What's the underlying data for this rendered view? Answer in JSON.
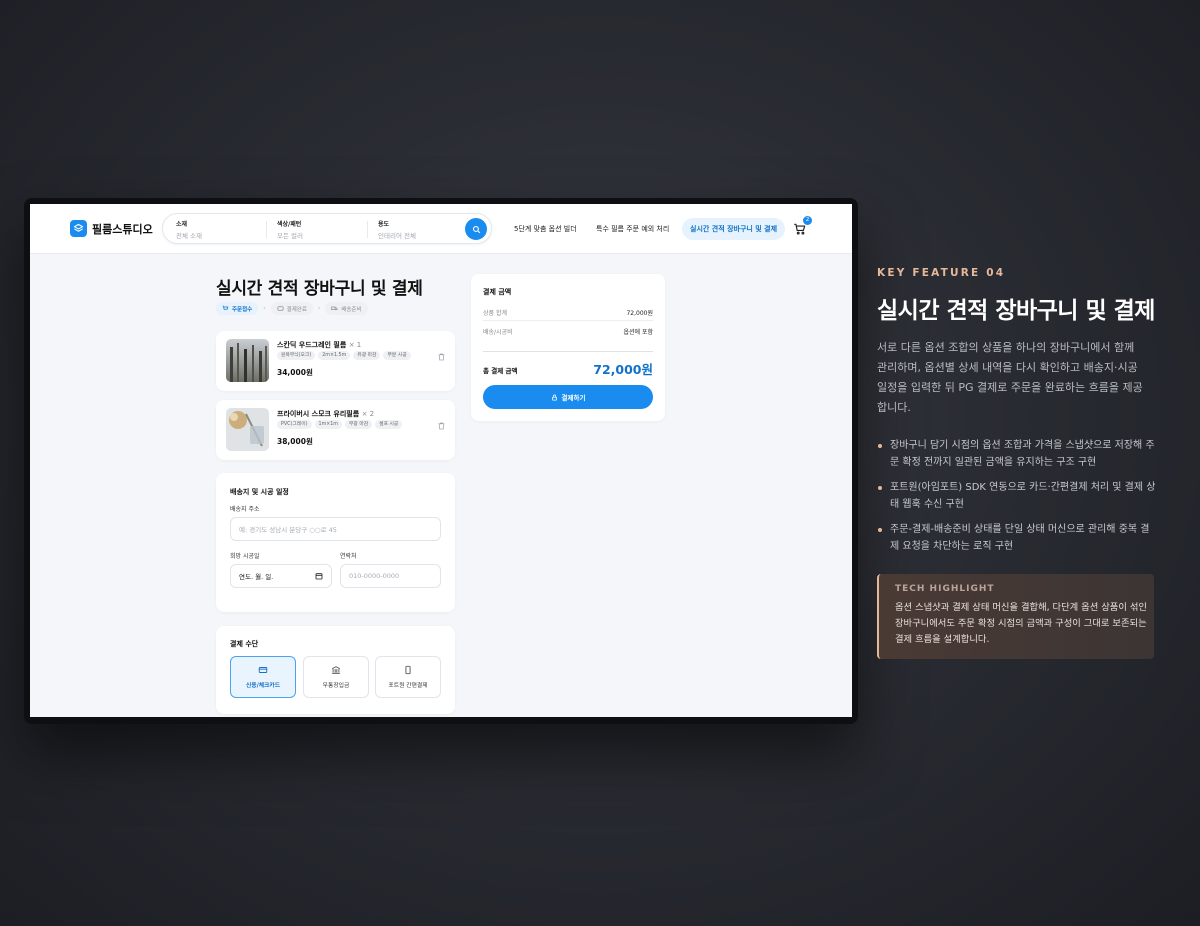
{
  "app": {
    "logo_text": "필름스튜디오",
    "search": [
      {
        "label": "소재",
        "value": "전체 소재"
      },
      {
        "label": "색상/패턴",
        "value": "모든 컬러"
      },
      {
        "label": "용도",
        "value": "인테리어 전체"
      }
    ],
    "nav": [
      "5단계 맞춤 옵션 빌더",
      "특수 필름 주문 예외 처리",
      "실시간 견적 장바구니 및 결제"
    ],
    "cart_count": "2"
  },
  "page": {
    "title": "실시간 견적 장바구니 및 결제",
    "steps": [
      "주문접수",
      "결제완료",
      "배송준비"
    ]
  },
  "cart": {
    "items": [
      {
        "name": "스칸딕 우드그레인 필름",
        "qty": "× 1",
        "tags": [
          "원목무늬(오크)",
          "2m×1.5m",
          "유광 마감",
          "부분 시공"
        ],
        "price": "34,000원"
      },
      {
        "name": "프라이버시 스모크 유리필름",
        "qty": "× 2",
        "tags": [
          "PVC(그레이)",
          "1m×1m",
          "무광 마감",
          "셀프 시공"
        ],
        "price": "38,000원"
      }
    ]
  },
  "shipping": {
    "title": "배송지 및 시공 일정",
    "address_label": "배송지 주소",
    "address_placeholder": "예: 경기도 성남시 분당구 ○○로 45",
    "date_label": "희망 시공일",
    "date_value": "연도. 월. 일.",
    "phone_label": "연락처",
    "phone_placeholder": "010-0000-0000"
  },
  "payment": {
    "title": "결제 수단",
    "options": [
      "신용/체크카드",
      "무통장입금",
      "포트원 간편결제"
    ]
  },
  "summary": {
    "title": "결제 금액",
    "rows": [
      {
        "label": "상품 합계",
        "value": "72,000원"
      },
      {
        "label": "배송/시공비",
        "value": "옵션에 포함"
      }
    ],
    "total_label": "총 결제 금액",
    "total_value": "72,000원",
    "pay_button": "결제하기"
  },
  "feature": {
    "eyebrow": "KEY FEATURE 04",
    "title": "실시간 견적 장바구니 및 결제",
    "description": "서로 다른 옵션 조합의 상품을 하나의 장바구니에서 함께 관리하며, 옵션별 상세 내역을 다시 확인하고 배송지·시공 일정을 입력한 뒤 PG 결제로 주문을 완료하는 흐름을 제공합니다.",
    "bullets": [
      "장바구니 담기 시점의 옵션 조합과 가격을 스냅샷으로 저장해 주문 확정 전까지 일관된 금액을 유지하는 구조 구현",
      "포트원(아임포트) SDK 연동으로 카드·간편결제 처리 및 결제 상태 웹훅 수신 구현",
      "주문-결제-배송준비 상태를 단일 상태 머신으로 관리해 중복 결제 요청을 차단하는 로직 구현"
    ],
    "tech_title": "TECH HIGHLIGHT",
    "tech_body": "옵션 스냅샷과 결제 상태 머신을 결합해, 다단계 옵션 상품이 섞인 장바구니에서도 주문 확정 시점의 금액과 구성이 그대로 보존되는 결제 흐름을 설계합니다."
  },
  "colors": {
    "accent": "#1a8cf0",
    "accent_text": "#1272c9",
    "feature_accent": "#e6b89a"
  }
}
